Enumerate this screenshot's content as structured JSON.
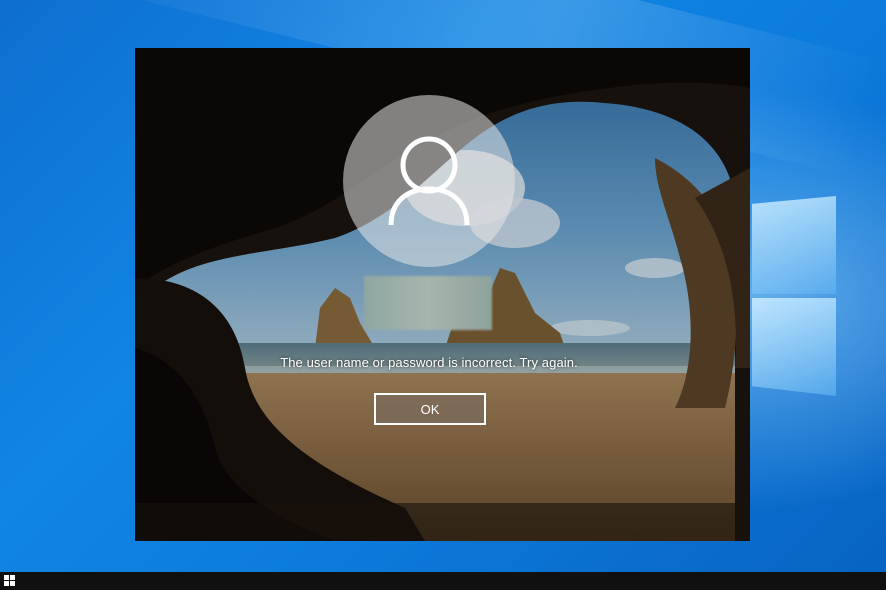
{
  "lock_screen": {
    "error_message": "The user name or password is incorrect. Try again.",
    "ok_label": "OK",
    "avatar_icon": "user-icon"
  },
  "taskbar": {
    "start_icon": "windows-start-icon"
  }
}
